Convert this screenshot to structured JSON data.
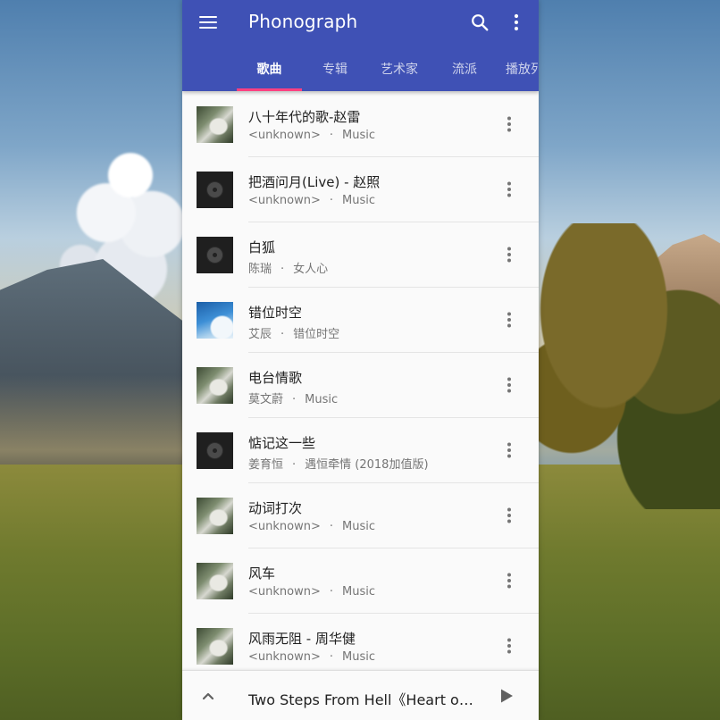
{
  "app": {
    "title": "Phonograph",
    "accent_color": "#3f51b5",
    "indicator_color": "#ff4081"
  },
  "toolbar": {
    "menu_icon": "menu-icon",
    "search_icon": "search-icon",
    "overflow_icon": "more-vert-icon"
  },
  "tabs": [
    {
      "label": "歌曲",
      "active": true
    },
    {
      "label": "专辑",
      "active": false
    },
    {
      "label": "艺术家",
      "active": false
    },
    {
      "label": "流派",
      "active": false
    },
    {
      "label": "播放列表",
      "active": false
    }
  ],
  "songs": [
    {
      "title": "八十年代的歌-赵雷",
      "artist": "<unknown>",
      "album": "Music",
      "art": "photo"
    },
    {
      "title": "把酒问月(Live) - 赵照",
      "artist": "<unknown>",
      "album": "Music",
      "art": "vinyl"
    },
    {
      "title": "白狐",
      "artist": "陈瑞",
      "album": "女人心",
      "art": "vinyl"
    },
    {
      "title": "错位时空",
      "artist": "艾辰",
      "album": "错位时空",
      "art": "blue"
    },
    {
      "title": "电台情歌",
      "artist": "莫文蔚",
      "album": "Music",
      "art": "photo"
    },
    {
      "title": "惦记这一些",
      "artist": "姜育恒",
      "album": "遇恒牵情 (2018加值版)",
      "art": "vinyl"
    },
    {
      "title": "动词打次",
      "artist": "<unknown>",
      "album": "Music",
      "art": "photo"
    },
    {
      "title": "风车",
      "artist": "<unknown>",
      "album": "Music",
      "art": "photo"
    },
    {
      "title": "风雨无阻 - 周华健",
      "artist": "<unknown>",
      "album": "Music",
      "art": "photo"
    }
  ],
  "separator": "·",
  "mini_player": {
    "now_playing": "Two Steps From Hell《Heart of Courage》",
    "expand_icon": "chevron-up-icon",
    "play_icon": "play-icon"
  }
}
